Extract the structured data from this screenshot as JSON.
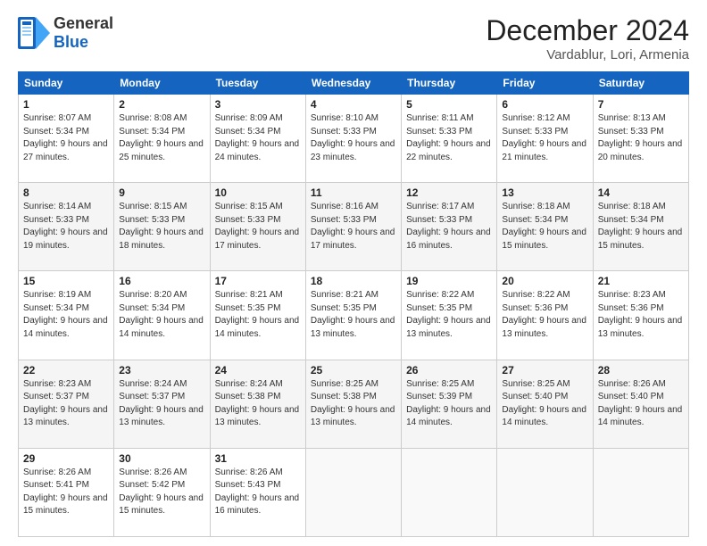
{
  "header": {
    "logo_general": "General",
    "logo_blue": "Blue",
    "month_title": "December 2024",
    "location": "Vardablur, Lori, Armenia"
  },
  "days_of_week": [
    "Sunday",
    "Monday",
    "Tuesday",
    "Wednesday",
    "Thursday",
    "Friday",
    "Saturday"
  ],
  "weeks": [
    [
      {
        "day": 1,
        "info": "Sunrise: 8:07 AM\nSunset: 5:34 PM\nDaylight: 9 hours and 27 minutes."
      },
      {
        "day": 2,
        "info": "Sunrise: 8:08 AM\nSunset: 5:34 PM\nDaylight: 9 hours and 25 minutes."
      },
      {
        "day": 3,
        "info": "Sunrise: 8:09 AM\nSunset: 5:34 PM\nDaylight: 9 hours and 24 minutes."
      },
      {
        "day": 4,
        "info": "Sunrise: 8:10 AM\nSunset: 5:33 PM\nDaylight: 9 hours and 23 minutes."
      },
      {
        "day": 5,
        "info": "Sunrise: 8:11 AM\nSunset: 5:33 PM\nDaylight: 9 hours and 22 minutes."
      },
      {
        "day": 6,
        "info": "Sunrise: 8:12 AM\nSunset: 5:33 PM\nDaylight: 9 hours and 21 minutes."
      },
      {
        "day": 7,
        "info": "Sunrise: 8:13 AM\nSunset: 5:33 PM\nDaylight: 9 hours and 20 minutes."
      }
    ],
    [
      {
        "day": 8,
        "info": "Sunrise: 8:14 AM\nSunset: 5:33 PM\nDaylight: 9 hours and 19 minutes."
      },
      {
        "day": 9,
        "info": "Sunrise: 8:15 AM\nSunset: 5:33 PM\nDaylight: 9 hours and 18 minutes."
      },
      {
        "day": 10,
        "info": "Sunrise: 8:15 AM\nSunset: 5:33 PM\nDaylight: 9 hours and 17 minutes."
      },
      {
        "day": 11,
        "info": "Sunrise: 8:16 AM\nSunset: 5:33 PM\nDaylight: 9 hours and 17 minutes."
      },
      {
        "day": 12,
        "info": "Sunrise: 8:17 AM\nSunset: 5:33 PM\nDaylight: 9 hours and 16 minutes."
      },
      {
        "day": 13,
        "info": "Sunrise: 8:18 AM\nSunset: 5:34 PM\nDaylight: 9 hours and 15 minutes."
      },
      {
        "day": 14,
        "info": "Sunrise: 8:18 AM\nSunset: 5:34 PM\nDaylight: 9 hours and 15 minutes."
      }
    ],
    [
      {
        "day": 15,
        "info": "Sunrise: 8:19 AM\nSunset: 5:34 PM\nDaylight: 9 hours and 14 minutes."
      },
      {
        "day": 16,
        "info": "Sunrise: 8:20 AM\nSunset: 5:34 PM\nDaylight: 9 hours and 14 minutes."
      },
      {
        "day": 17,
        "info": "Sunrise: 8:21 AM\nSunset: 5:35 PM\nDaylight: 9 hours and 14 minutes."
      },
      {
        "day": 18,
        "info": "Sunrise: 8:21 AM\nSunset: 5:35 PM\nDaylight: 9 hours and 13 minutes."
      },
      {
        "day": 19,
        "info": "Sunrise: 8:22 AM\nSunset: 5:35 PM\nDaylight: 9 hours and 13 minutes."
      },
      {
        "day": 20,
        "info": "Sunrise: 8:22 AM\nSunset: 5:36 PM\nDaylight: 9 hours and 13 minutes."
      },
      {
        "day": 21,
        "info": "Sunrise: 8:23 AM\nSunset: 5:36 PM\nDaylight: 9 hours and 13 minutes."
      }
    ],
    [
      {
        "day": 22,
        "info": "Sunrise: 8:23 AM\nSunset: 5:37 PM\nDaylight: 9 hours and 13 minutes."
      },
      {
        "day": 23,
        "info": "Sunrise: 8:24 AM\nSunset: 5:37 PM\nDaylight: 9 hours and 13 minutes."
      },
      {
        "day": 24,
        "info": "Sunrise: 8:24 AM\nSunset: 5:38 PM\nDaylight: 9 hours and 13 minutes."
      },
      {
        "day": 25,
        "info": "Sunrise: 8:25 AM\nSunset: 5:38 PM\nDaylight: 9 hours and 13 minutes."
      },
      {
        "day": 26,
        "info": "Sunrise: 8:25 AM\nSunset: 5:39 PM\nDaylight: 9 hours and 14 minutes."
      },
      {
        "day": 27,
        "info": "Sunrise: 8:25 AM\nSunset: 5:40 PM\nDaylight: 9 hours and 14 minutes."
      },
      {
        "day": 28,
        "info": "Sunrise: 8:26 AM\nSunset: 5:40 PM\nDaylight: 9 hours and 14 minutes."
      }
    ],
    [
      {
        "day": 29,
        "info": "Sunrise: 8:26 AM\nSunset: 5:41 PM\nDaylight: 9 hours and 15 minutes."
      },
      {
        "day": 30,
        "info": "Sunrise: 8:26 AM\nSunset: 5:42 PM\nDaylight: 9 hours and 15 minutes."
      },
      {
        "day": 31,
        "info": "Sunrise: 8:26 AM\nSunset: 5:43 PM\nDaylight: 9 hours and 16 minutes."
      },
      null,
      null,
      null,
      null
    ]
  ]
}
